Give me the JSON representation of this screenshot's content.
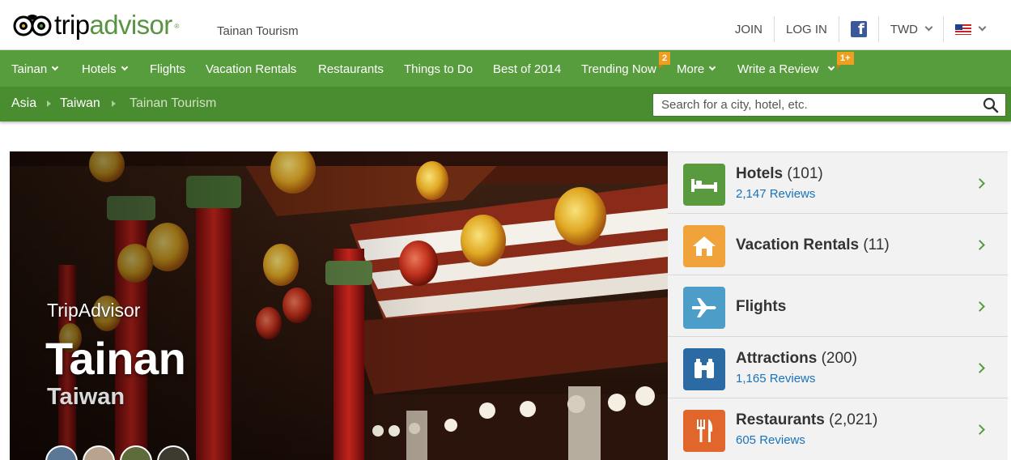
{
  "header": {
    "logo_part1": "trip",
    "logo_part2": "advisor",
    "logo_tm": "®",
    "site_tag": "Tainan Tourism",
    "join": "JOIN",
    "login": "LOG IN",
    "facebook_glyph": "f",
    "currency": "TWD"
  },
  "nav": {
    "items": [
      {
        "label": "Tainan"
      },
      {
        "label": "Hotels"
      },
      {
        "label": "Flights"
      },
      {
        "label": "Vacation Rentals"
      },
      {
        "label": "Restaurants"
      },
      {
        "label": "Things to Do"
      },
      {
        "label": "Best of 2014"
      },
      {
        "label": "Trending Now",
        "badge": "2"
      },
      {
        "label": "More"
      },
      {
        "label": "Write a Review",
        "badge": "1+"
      }
    ]
  },
  "breadcrumb": [
    "Asia",
    "Taiwan",
    "Tainan Tourism"
  ],
  "search": {
    "placeholder": "Search for a city, hotel, etc."
  },
  "hero": {
    "kicker": "TripAdvisor",
    "title": "Tainan",
    "subtitle": "Taiwan"
  },
  "categories": [
    {
      "name": "Hotels",
      "count": "(101)",
      "reviews": "2,147 Reviews",
      "icon": "bed-icon",
      "color": "#5a9a3e"
    },
    {
      "name": "Vacation Rentals",
      "count": "(11)",
      "reviews": "",
      "icon": "house-icon",
      "color": "#f0a33a"
    },
    {
      "name": "Flights",
      "count": "",
      "reviews": "",
      "icon": "airplane-icon",
      "color": "#4c9ec9"
    },
    {
      "name": "Attractions",
      "count": "(200)",
      "reviews": "1,165 Reviews",
      "icon": "binoculars-icon",
      "color": "#2b6aa3"
    },
    {
      "name": "Restaurants",
      "count": "(2,021)",
      "reviews": "605 Reviews",
      "icon": "fork-knife-icon",
      "color": "#e0662b"
    }
  ],
  "colors": {
    "brand_green": "#589442",
    "nav_green": "#579d3d",
    "crumb_green": "#4a8c30",
    "badge_orange": "#f09e1f",
    "link_blue": "#1a73ba"
  }
}
